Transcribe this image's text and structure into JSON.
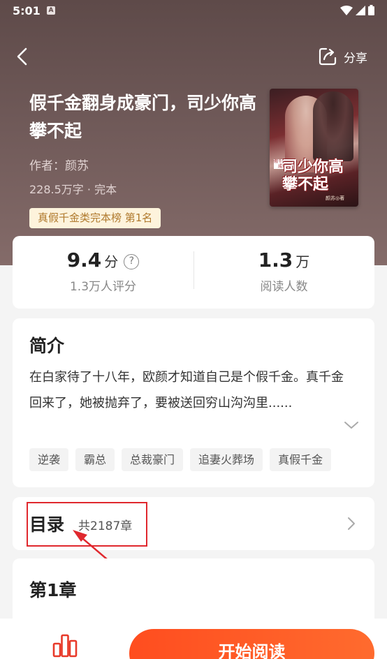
{
  "status_bar": {
    "time": "5:01",
    "notification_letter": "A"
  },
  "header": {
    "share_label": "分享"
  },
  "book": {
    "title": "假千金翻身成豪门，司少你高攀不起",
    "author": "作者：颜苏",
    "meta": "228.5万字 · 完本",
    "rank_badge": "真假千金类完本榜  第1名",
    "cover": {
      "tag": "假千金翻身成豪门",
      "title": "司少你高攀不起",
      "author": "颜苏◎著"
    }
  },
  "stats": {
    "rating": {
      "value": "9.4",
      "unit": "分",
      "help": "?",
      "label": "1.3万人评分"
    },
    "readers": {
      "value": "1.3",
      "unit": "万",
      "label": "阅读人数"
    }
  },
  "intro": {
    "heading": "简介",
    "text": "在白家待了十八年，欧颜才知道自己是个假千金。真千金回来了，她被抛弃了，要被送回穷山沟沟里......",
    "tags": [
      "逆袭",
      "霸总",
      "总裁豪门",
      "追妻火葬场",
      "真假千金"
    ]
  },
  "toc": {
    "title": "目录",
    "count": "共2187章"
  },
  "chapter": {
    "title": "第1章"
  },
  "bottom": {
    "start_label": "开始阅读"
  },
  "colors": {
    "accent": "#ff5a22",
    "highlight": "#e0282e",
    "hero": "#6f5958"
  }
}
